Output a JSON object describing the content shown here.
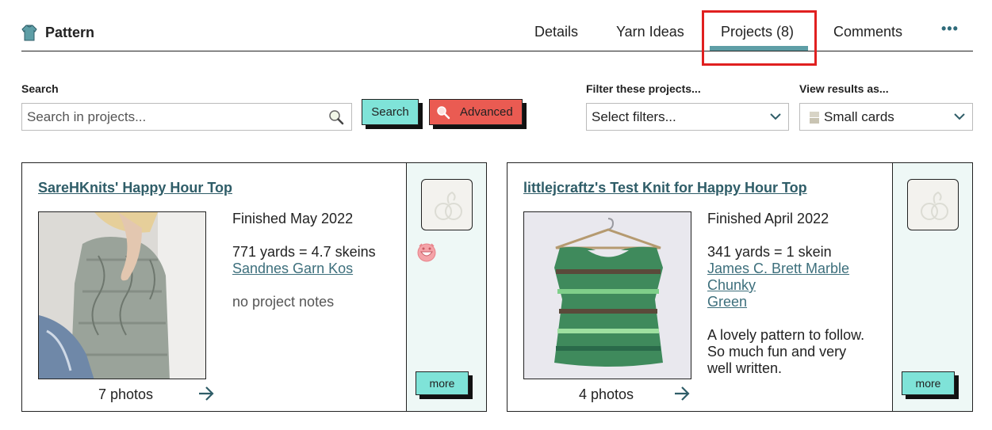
{
  "header": {
    "title": "Pattern",
    "tabs": [
      {
        "label": "Details"
      },
      {
        "label": "Yarn Ideas"
      },
      {
        "label": "Projects (8)"
      },
      {
        "label": "Comments"
      },
      {
        "label": "•••"
      }
    ]
  },
  "search": {
    "label": "Search",
    "placeholder": "Search in projects...",
    "search_button": "Search",
    "advanced_button": "Advanced"
  },
  "filters": {
    "label": "Filter these projects...",
    "value": "Select filters..."
  },
  "view": {
    "label": "View results as...",
    "value": "Small cards"
  },
  "colors": {
    "accent_teal": "#7fe3d8",
    "advanced_red": "#ea5b52",
    "link": "#3d6f7c",
    "highlight": "#e02020"
  },
  "projects": [
    {
      "title": "SareHKnits' Happy Hour Top",
      "status": "Finished May 2022",
      "yardage": "771 yards = 4.7 skeins",
      "yarn_lines": [
        "Sandnes Garn Kos"
      ],
      "notes": [
        "no project notes"
      ],
      "notes_empty": true,
      "photos": "7 photos",
      "more": "more"
    },
    {
      "title": "littlejcraftz's Test Knit for Happy Hour Top",
      "status": "Finished April 2022",
      "yardage": "341 yards = 1 skein",
      "yarn_lines": [
        "James C. Brett Marble",
        "Chunky",
        "Green"
      ],
      "notes": [
        "A lovely pattern to follow.",
        "So much fun and very",
        "well written."
      ],
      "notes_empty": false,
      "photos": "4 photos",
      "more": "more"
    }
  ]
}
